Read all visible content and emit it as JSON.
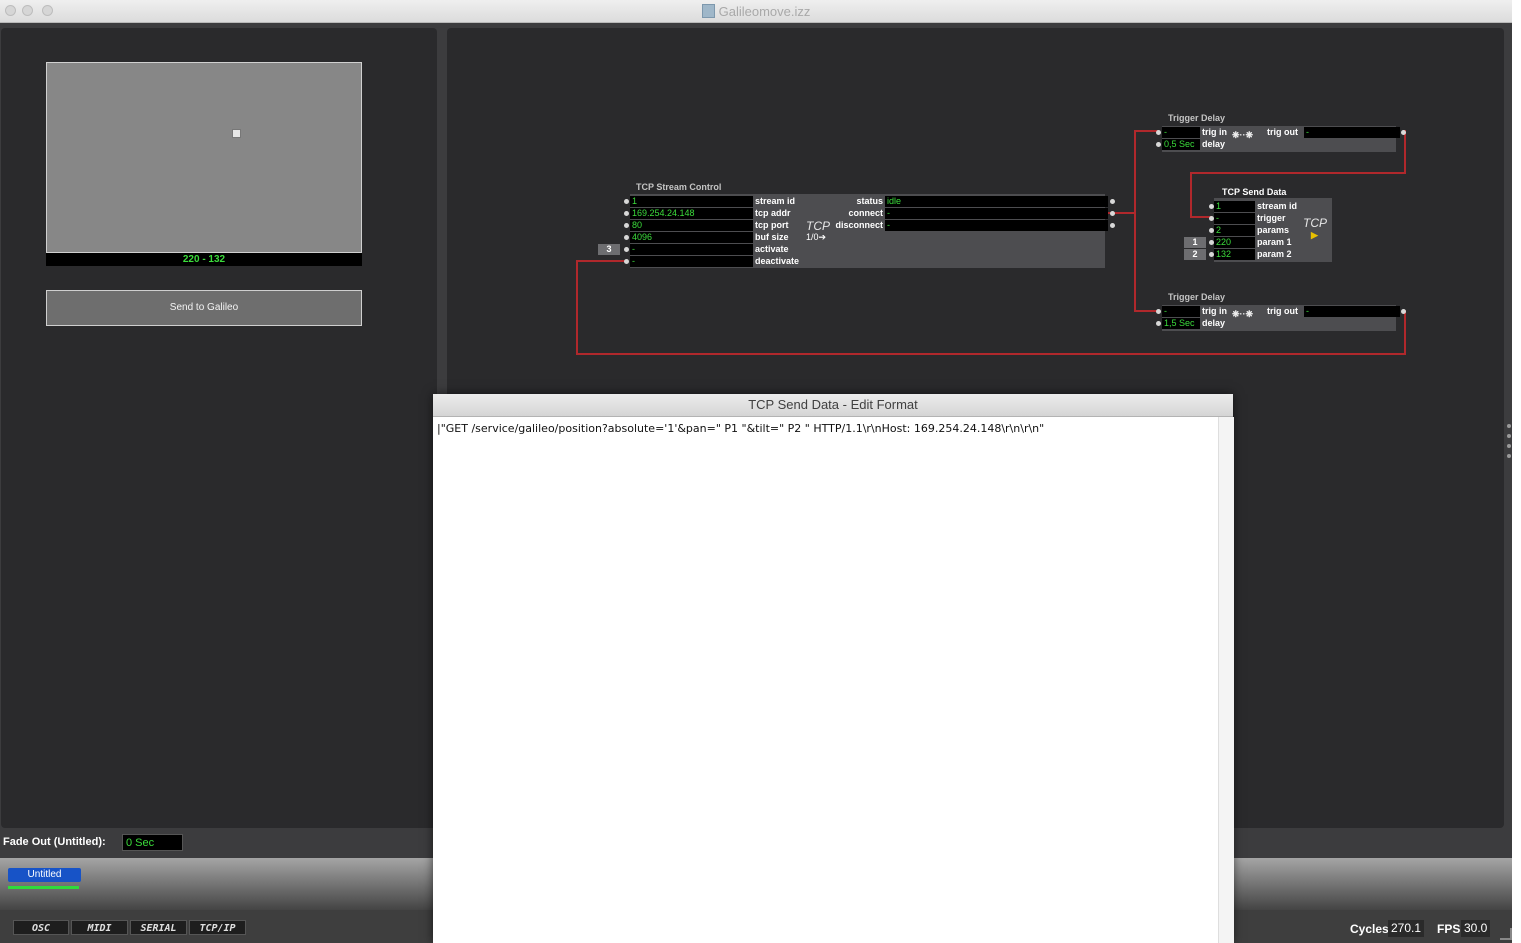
{
  "window": {
    "title": "Galileomove.izz"
  },
  "stage": {
    "xy_readout": "220 - 132",
    "send_button_label": "Send to Galileo"
  },
  "tcp_stream_control": {
    "title": "TCP Stream Control",
    "inputs": [
      {
        "value": "1",
        "label": "stream id"
      },
      {
        "value": "169.254.24.148",
        "label": "tcp addr"
      },
      {
        "value": "80",
        "label": "tcp port"
      },
      {
        "value": "4096",
        "label": "buf size"
      },
      {
        "value": "-",
        "label": "activate"
      },
      {
        "value": "-",
        "label": "deactivate"
      }
    ],
    "activate_number": "3",
    "outputs": [
      {
        "label": "status",
        "value": "idle"
      },
      {
        "label": "connect",
        "value": "-"
      },
      {
        "label": "disconnect",
        "value": "-"
      }
    ],
    "glyph": "TCP",
    "io_text": "1/0"
  },
  "trigger_delay_1": {
    "title": "Trigger Delay",
    "trig_in_value": "-",
    "trig_in_label": "trig in",
    "delay_value": "0,5 Sec",
    "delay_label": "delay",
    "trig_out_label": "trig out",
    "trig_out_value": "-"
  },
  "trigger_delay_2": {
    "title": "Trigger Delay",
    "trig_in_value": "-",
    "trig_in_label": "trig in",
    "delay_value": "1,5 Sec",
    "delay_label": "delay",
    "trig_out_label": "trig out",
    "trig_out_value": "-"
  },
  "tcp_send_data": {
    "title": "TCP Send Data",
    "inputs": [
      {
        "value": "1",
        "label": "stream id"
      },
      {
        "value": "-",
        "label": "trigger"
      },
      {
        "value": "2",
        "label": "params"
      },
      {
        "value": "220",
        "label": "param 1"
      },
      {
        "value": "132",
        "label": "param 2"
      }
    ],
    "param_numbers": [
      "1",
      "2"
    ],
    "glyph": "TCP"
  },
  "edit_format_dialog": {
    "title": "TCP Send Data - Edit Format",
    "text": "\"GET /service/galileo/position?absolute='1'&pan=\" P1 \"&tilt=\" P2 \" HTTP/1.1\\r\\nHost: 169.254.24.148\\r\\n\\r\\n\""
  },
  "fade_out": {
    "label": "Fade Out (Untitled):",
    "value": "0 Sec"
  },
  "scene_tab": {
    "label": "Untitled"
  },
  "protocol_buttons": [
    "OSC",
    "MIDI",
    "SERIAL",
    "TCP/IP"
  ],
  "stats": {
    "cycles_label": "Cycles",
    "cycles_value": "270.1",
    "fps_label": "FPS",
    "fps_value": "30.0"
  },
  "colors": {
    "wire": "#b0282c",
    "value_text": "#3bdc3b",
    "scene_tab": "#1753c7"
  }
}
